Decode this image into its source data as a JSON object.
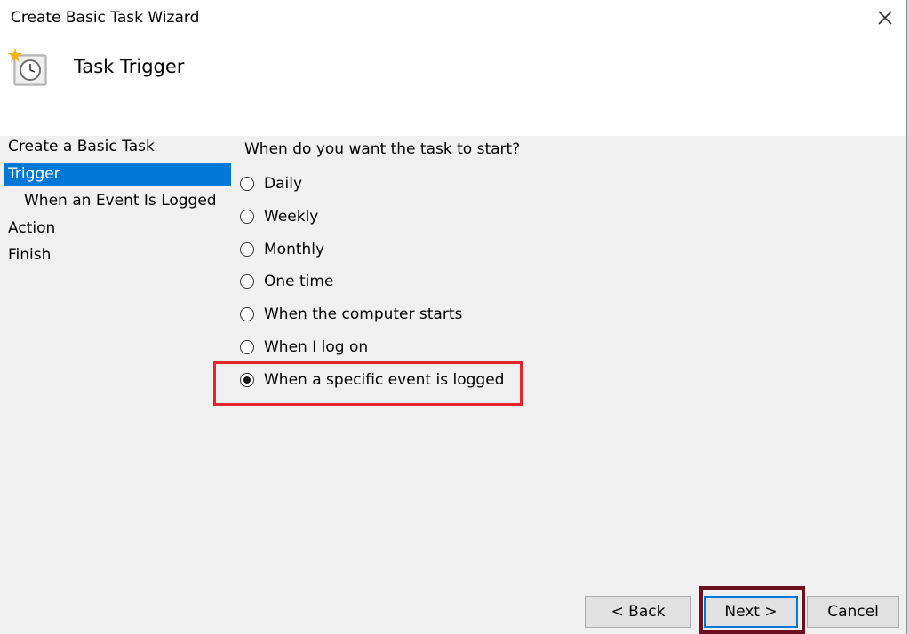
{
  "window": {
    "title": "Create Basic Task Wizard"
  },
  "header": {
    "heading": "Task Trigger"
  },
  "nav": {
    "items": [
      {
        "label": "Create a Basic Task"
      },
      {
        "label": "Trigger"
      },
      {
        "label": "When an Event Is Logged"
      },
      {
        "label": "Action"
      },
      {
        "label": "Finish"
      }
    ],
    "selected": "Trigger"
  },
  "main": {
    "prompt": "When do you want the task to start?",
    "options": [
      {
        "label": "Daily"
      },
      {
        "label": "Weekly"
      },
      {
        "label": "Monthly"
      },
      {
        "label": "One time"
      },
      {
        "label": "When the computer starts"
      },
      {
        "label": "When I log on"
      },
      {
        "label": "When a specific event is logged"
      }
    ],
    "selected_option": "When a specific event is logged"
  },
  "buttons": {
    "back": "< Back",
    "next": "Next >",
    "cancel": "Cancel"
  },
  "colors": {
    "selection": "#0078d7",
    "highlight_red": "#e3262e",
    "highlight_dark": "#6d0f1f"
  },
  "icons": {
    "app": "task-scheduler-clock-icon",
    "close": "close-icon"
  }
}
